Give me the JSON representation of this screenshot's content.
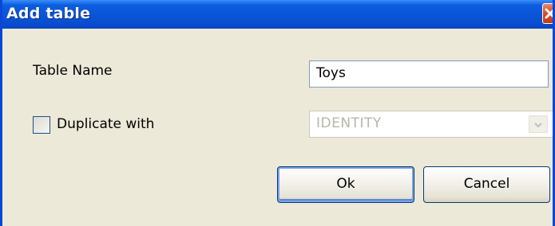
{
  "window": {
    "title": "Add table"
  },
  "form": {
    "table_name_label": "Table Name",
    "table_name_value": "Toys",
    "duplicate_label": "Duplicate with",
    "duplicate_checked": false,
    "duplicate_select_value": "IDENTITY"
  },
  "buttons": {
    "ok_label": "Ok",
    "cancel_label": "Cancel"
  },
  "icons": {
    "close": "close-icon",
    "dropdown": "chevron-down-icon"
  },
  "colors": {
    "titlebar": "#0a55d6",
    "close_button": "#d8532f",
    "dialog_background": "#ece9d8"
  }
}
